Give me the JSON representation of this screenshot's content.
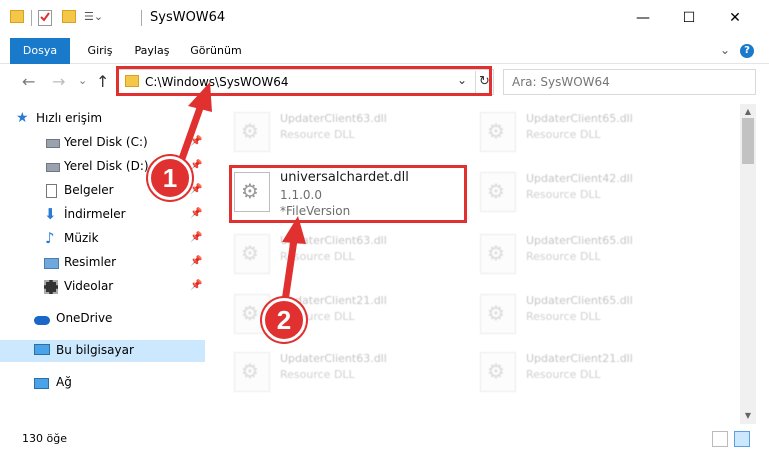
{
  "window": {
    "title": "SysWOW64",
    "minimize": "—",
    "maximize": "☐",
    "close": "✕"
  },
  "ribbon": {
    "tabs": [
      "Dosya",
      "Giriş",
      "Paylaş",
      "Görünüm"
    ],
    "expand": "⌄",
    "help": "?"
  },
  "nav": {
    "back": "←",
    "forward": "→",
    "recent": "⌄",
    "up": "↑",
    "path": "C:\\Windows\\SysWOW64",
    "dropdown": "⌄",
    "refresh": "↻",
    "search_placeholder": "Ara: SysWOW64"
  },
  "sidebar": {
    "items": [
      {
        "label": "Hızlı erişim",
        "icon": "star-icon"
      },
      {
        "label": "Yerel Disk (C:)",
        "icon": "drive-icon"
      },
      {
        "label": "Yerel Disk (D:)",
        "icon": "drive-icon"
      },
      {
        "label": "Belgeler",
        "icon": "document-icon"
      },
      {
        "label": "İndirmeler",
        "icon": "download-icon"
      },
      {
        "label": "Müzik",
        "icon": "music-icon"
      },
      {
        "label": "Resimler",
        "icon": "pictures-icon"
      },
      {
        "label": "Videolar",
        "icon": "video-icon"
      },
      {
        "label": "OneDrive",
        "icon": "cloud-icon"
      },
      {
        "label": "Bu bilgisayar",
        "icon": "computer-icon"
      },
      {
        "label": "Ağ",
        "icon": "network-icon"
      }
    ],
    "pin": "📌"
  },
  "files": {
    "main": {
      "name": "universalchardet.dll",
      "version": "1.1.0.0",
      "desc": "*FileVersion"
    },
    "background": [
      {
        "name": "UpdaterClient63.dll",
        "desc": "Resource DLL"
      },
      {
        "name": "UpdaterClient65.dll",
        "desc": "Resource DLL"
      },
      {
        "name": "UpdaterClient42.dll",
        "desc": "Resource DLL"
      },
      {
        "name": "UpdaterClient63.dll",
        "desc": "Resource DLL"
      },
      {
        "name": "UpdaterClient65.dll",
        "desc": "Resource DLL"
      },
      {
        "name": "UpdaterClient21.dll",
        "desc": "Resource DLL"
      },
      {
        "name": "UpdaterClient65.dll",
        "desc": "Resource DLL"
      },
      {
        "name": "UpdaterClient63.dll",
        "desc": "Resource DLL"
      },
      {
        "name": "UpdaterClient21.dll",
        "desc": "Resource DLL"
      }
    ]
  },
  "status": {
    "count": "130 öğe"
  },
  "callouts": {
    "one": "1",
    "two": "2"
  },
  "colors": {
    "accent": "#1979ca",
    "highlight": "#e0302f",
    "selected": "#cce8ff"
  }
}
